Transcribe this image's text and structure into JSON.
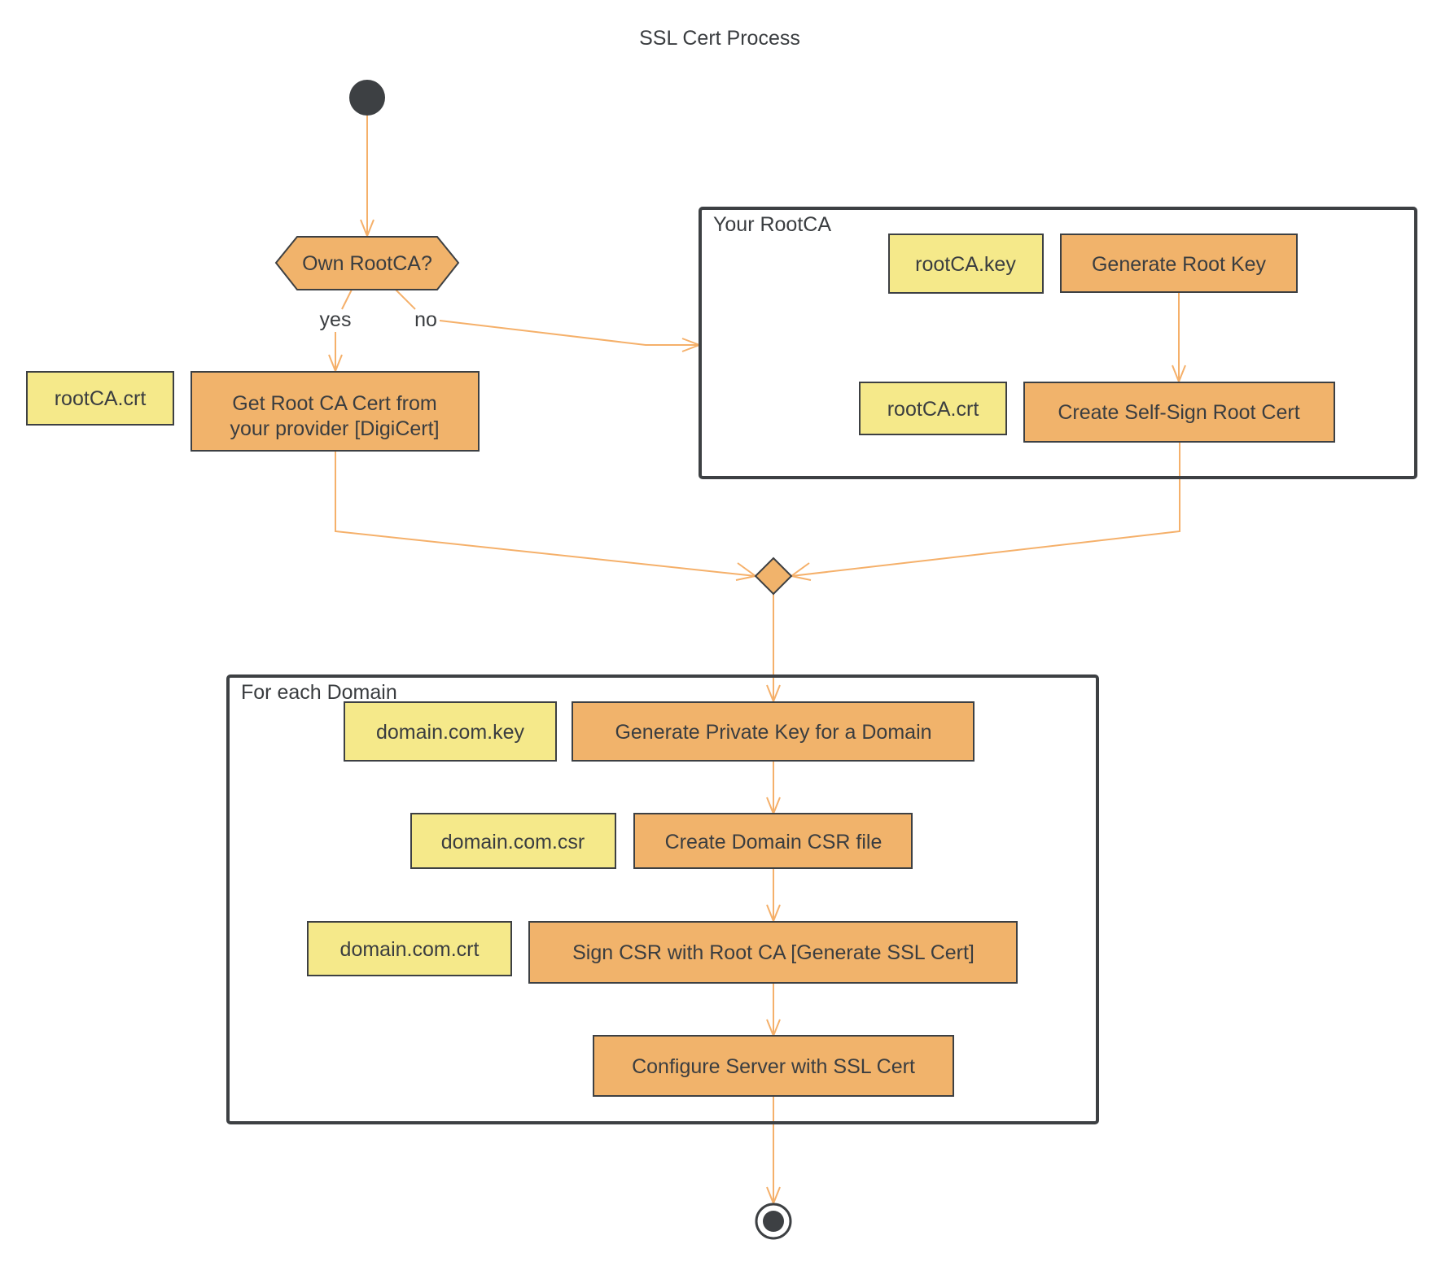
{
  "title": "SSL Cert Process",
  "colors": {
    "action_fill": "#F1B36B",
    "object_fill": "#F5E98A",
    "edge": "#F5B06A",
    "stroke": "#3d4043",
    "text": "#3a3d40"
  },
  "decision": {
    "label": "Own RootCA?",
    "branches": {
      "yes": "yes",
      "no": "no"
    }
  },
  "left_path": {
    "object": "rootCA.crt",
    "action_line1": "Get Root CA Cert from",
    "action_line2": "your provider [DigiCert]"
  },
  "groups": {
    "root_ca": {
      "label": "Your RootCA",
      "rows": [
        {
          "object": "rootCA.key",
          "action": "Generate Root Key"
        },
        {
          "object": "rootCA.crt",
          "action": "Create Self-Sign Root Cert"
        }
      ]
    },
    "domain": {
      "label": "For each Domain",
      "rows": [
        {
          "object": "domain.com.key",
          "action": "Generate Private Key for a Domain"
        },
        {
          "object": "domain.com.csr",
          "action": "Create Domain CSR file"
        },
        {
          "object": "domain.com.crt",
          "action": "Sign CSR with Root CA [Generate SSL Cert]"
        },
        {
          "object": null,
          "action": "Configure Server with SSL Cert"
        }
      ]
    }
  }
}
